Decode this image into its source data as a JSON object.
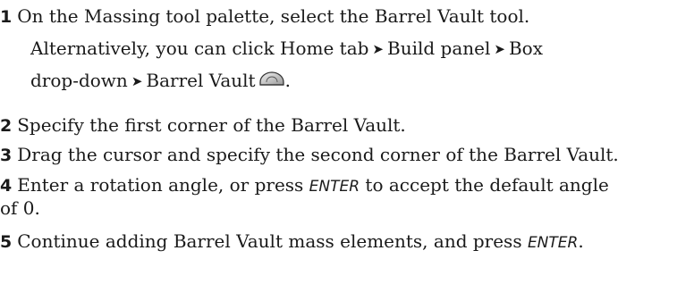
{
  "steps": [
    {
      "number": "1",
      "text": "On the Massing tool palette, select the Barrel Vault tool.",
      "alt_prefix": "Alternatively, you can click ",
      "path": [
        "Home tab",
        "Build panel",
        "Box"
      ],
      "path_cont": [
        "drop-down",
        "Barrel Vault"
      ],
      "icon": "barrel-vault-icon",
      "end": "."
    },
    {
      "number": "2",
      "text": "Specify the first corner of the Barrel Vault."
    },
    {
      "number": "3",
      "text": "Drag the cursor and specify the second corner of the Barrel Vault."
    },
    {
      "number": "4",
      "text_a": "Enter a rotation angle, or press ",
      "key": "ENTER",
      "text_b": " to accept the default angle",
      "text_c": "of 0."
    },
    {
      "number": "5",
      "text_a": "Continue adding Barrel Vault mass elements, and press ",
      "key": "ENTER",
      "text_b": "."
    }
  ],
  "separator_glyph": "➤"
}
